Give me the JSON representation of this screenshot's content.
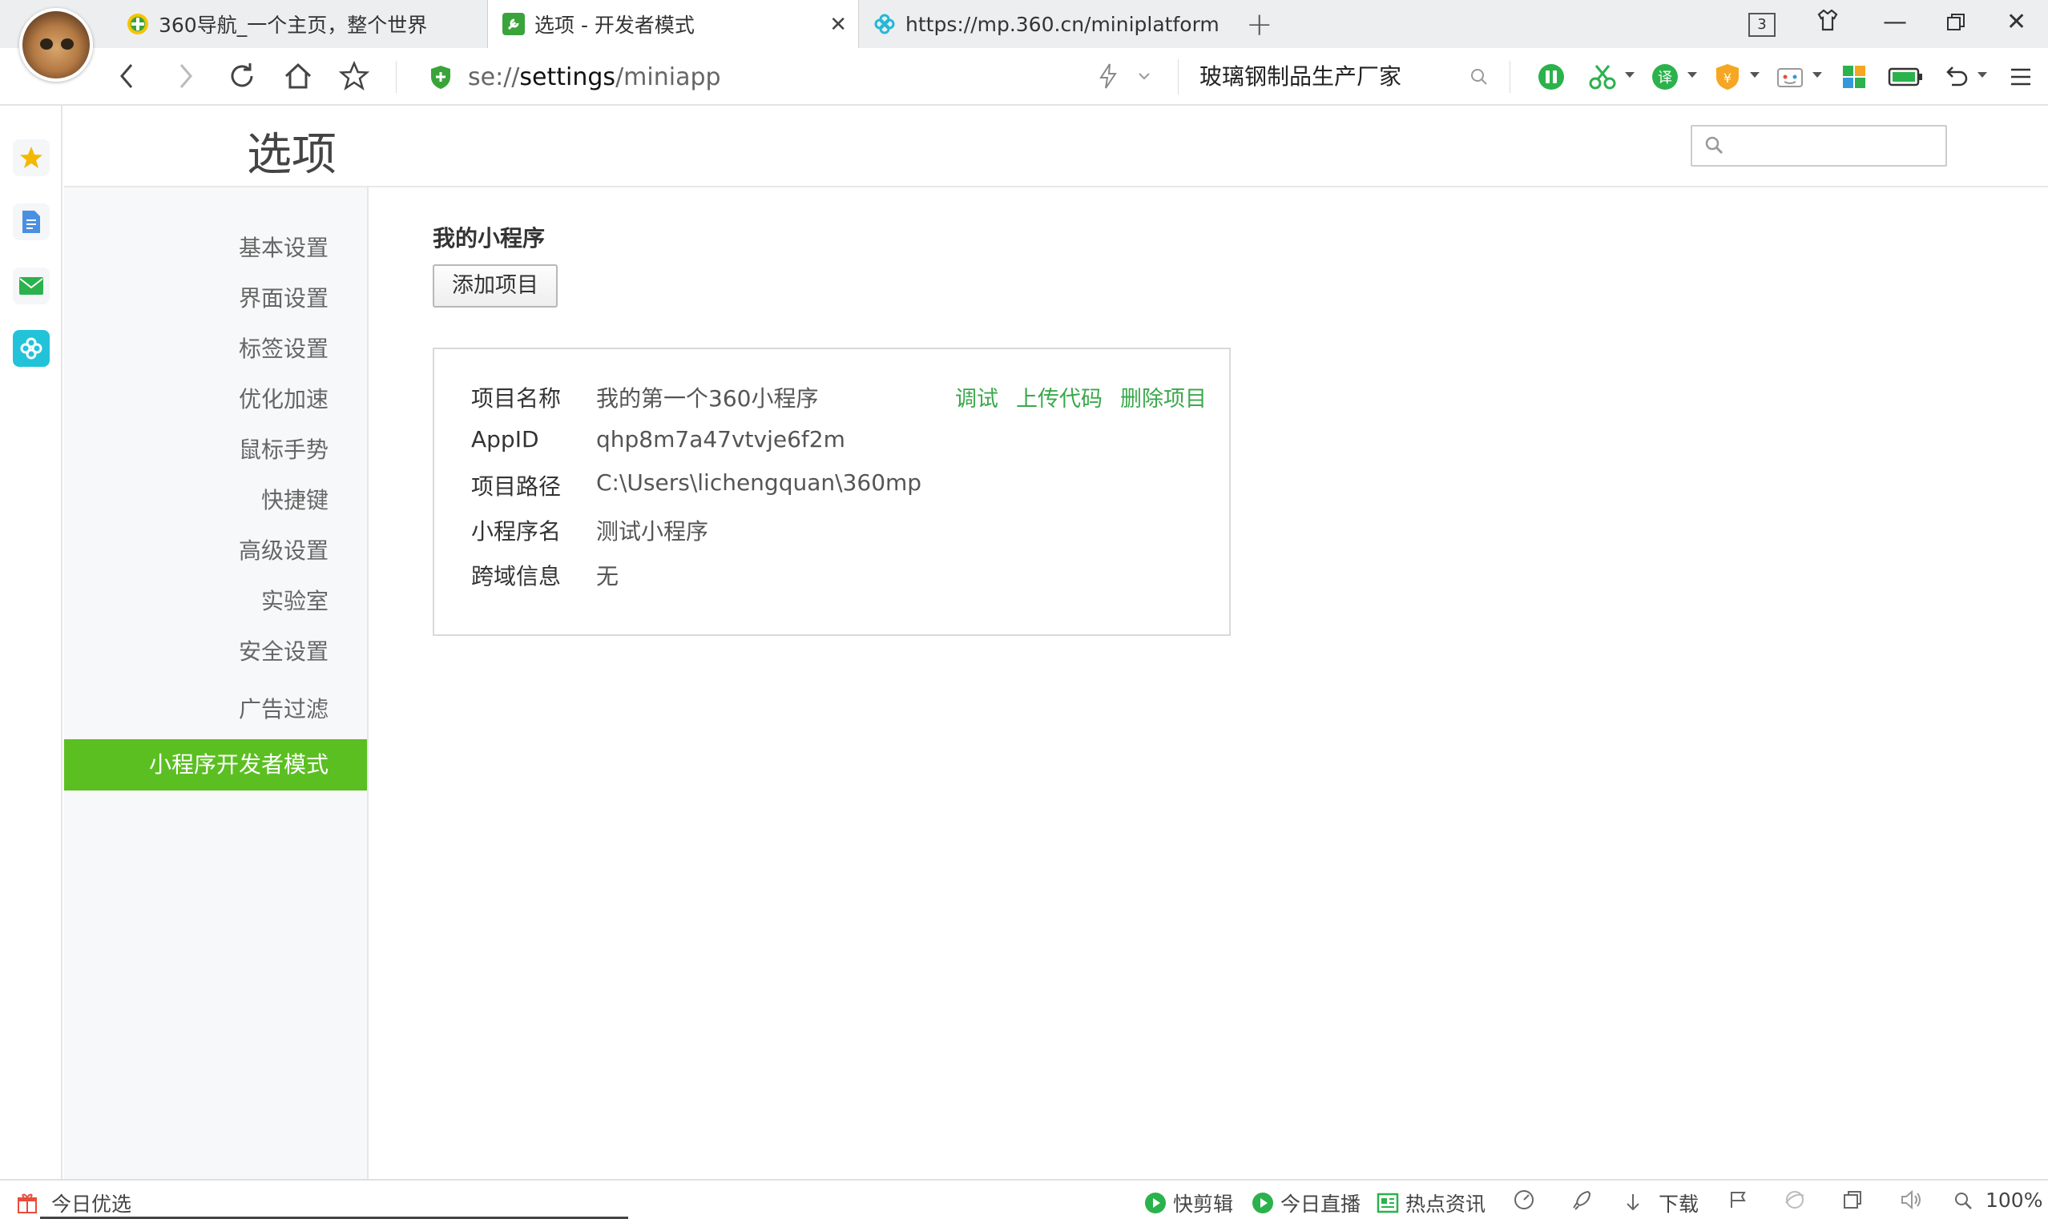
{
  "tabs": [
    {
      "title": "360导航_一个主页，整个世界",
      "icon": "360-nav-icon"
    },
    {
      "title": "选项 - 开发者模式",
      "icon": "wrench-icon"
    },
    {
      "title": "https://mp.360.cn/miniplatform",
      "icon": "miniapp-icon"
    }
  ],
  "tab_count": "3",
  "address": {
    "scheme": "se://",
    "host": "settings",
    "path": "/miniapp"
  },
  "search_query": "玻璃钢制品生产厂家",
  "page": {
    "title": "选项",
    "search_placeholder": ""
  },
  "menu": [
    "基本设置",
    "界面设置",
    "标签设置",
    "优化加速",
    "鼠标手势",
    "快捷键",
    "高级设置",
    "实验室",
    "安全设置",
    "广告过滤",
    "小程序开发者模式"
  ],
  "active_menu_index": 10,
  "section": {
    "title": "我的小程序",
    "add_button": "添加项目"
  },
  "project": {
    "labels": {
      "name": "项目名称",
      "appid": "AppID",
      "path": "项目路径",
      "mininame": "小程序名",
      "cors": "跨域信息"
    },
    "values": {
      "name": "我的第一个360小程序",
      "appid": "qhp8m7a47vtvje6f2m",
      "path": "C:\\Users\\lichengquan\\360mp",
      "mininame": "测试小程序",
      "cors": "无"
    },
    "actions": {
      "debug": "调试",
      "upload": "上传代码",
      "delete": "删除项目"
    }
  },
  "status": {
    "left": "今日优选",
    "quick_edit": "快剪辑",
    "live": "今日直播",
    "news": "热点资讯",
    "download": "下载",
    "zoom": "100%"
  },
  "colors": {
    "accent": "#5bbf22",
    "link": "#3aa84a"
  }
}
